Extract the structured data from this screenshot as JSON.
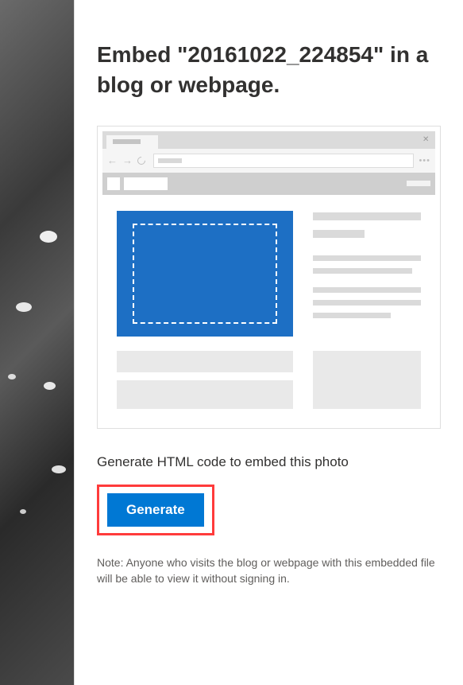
{
  "title": "Embed \"20161022_224854\" in a blog or webpage.",
  "instruction": "Generate HTML code to embed this photo",
  "button_label": "Generate",
  "note": "Note: Anyone who visits the blog or webpage with this embedded file will be able to view it without signing in."
}
